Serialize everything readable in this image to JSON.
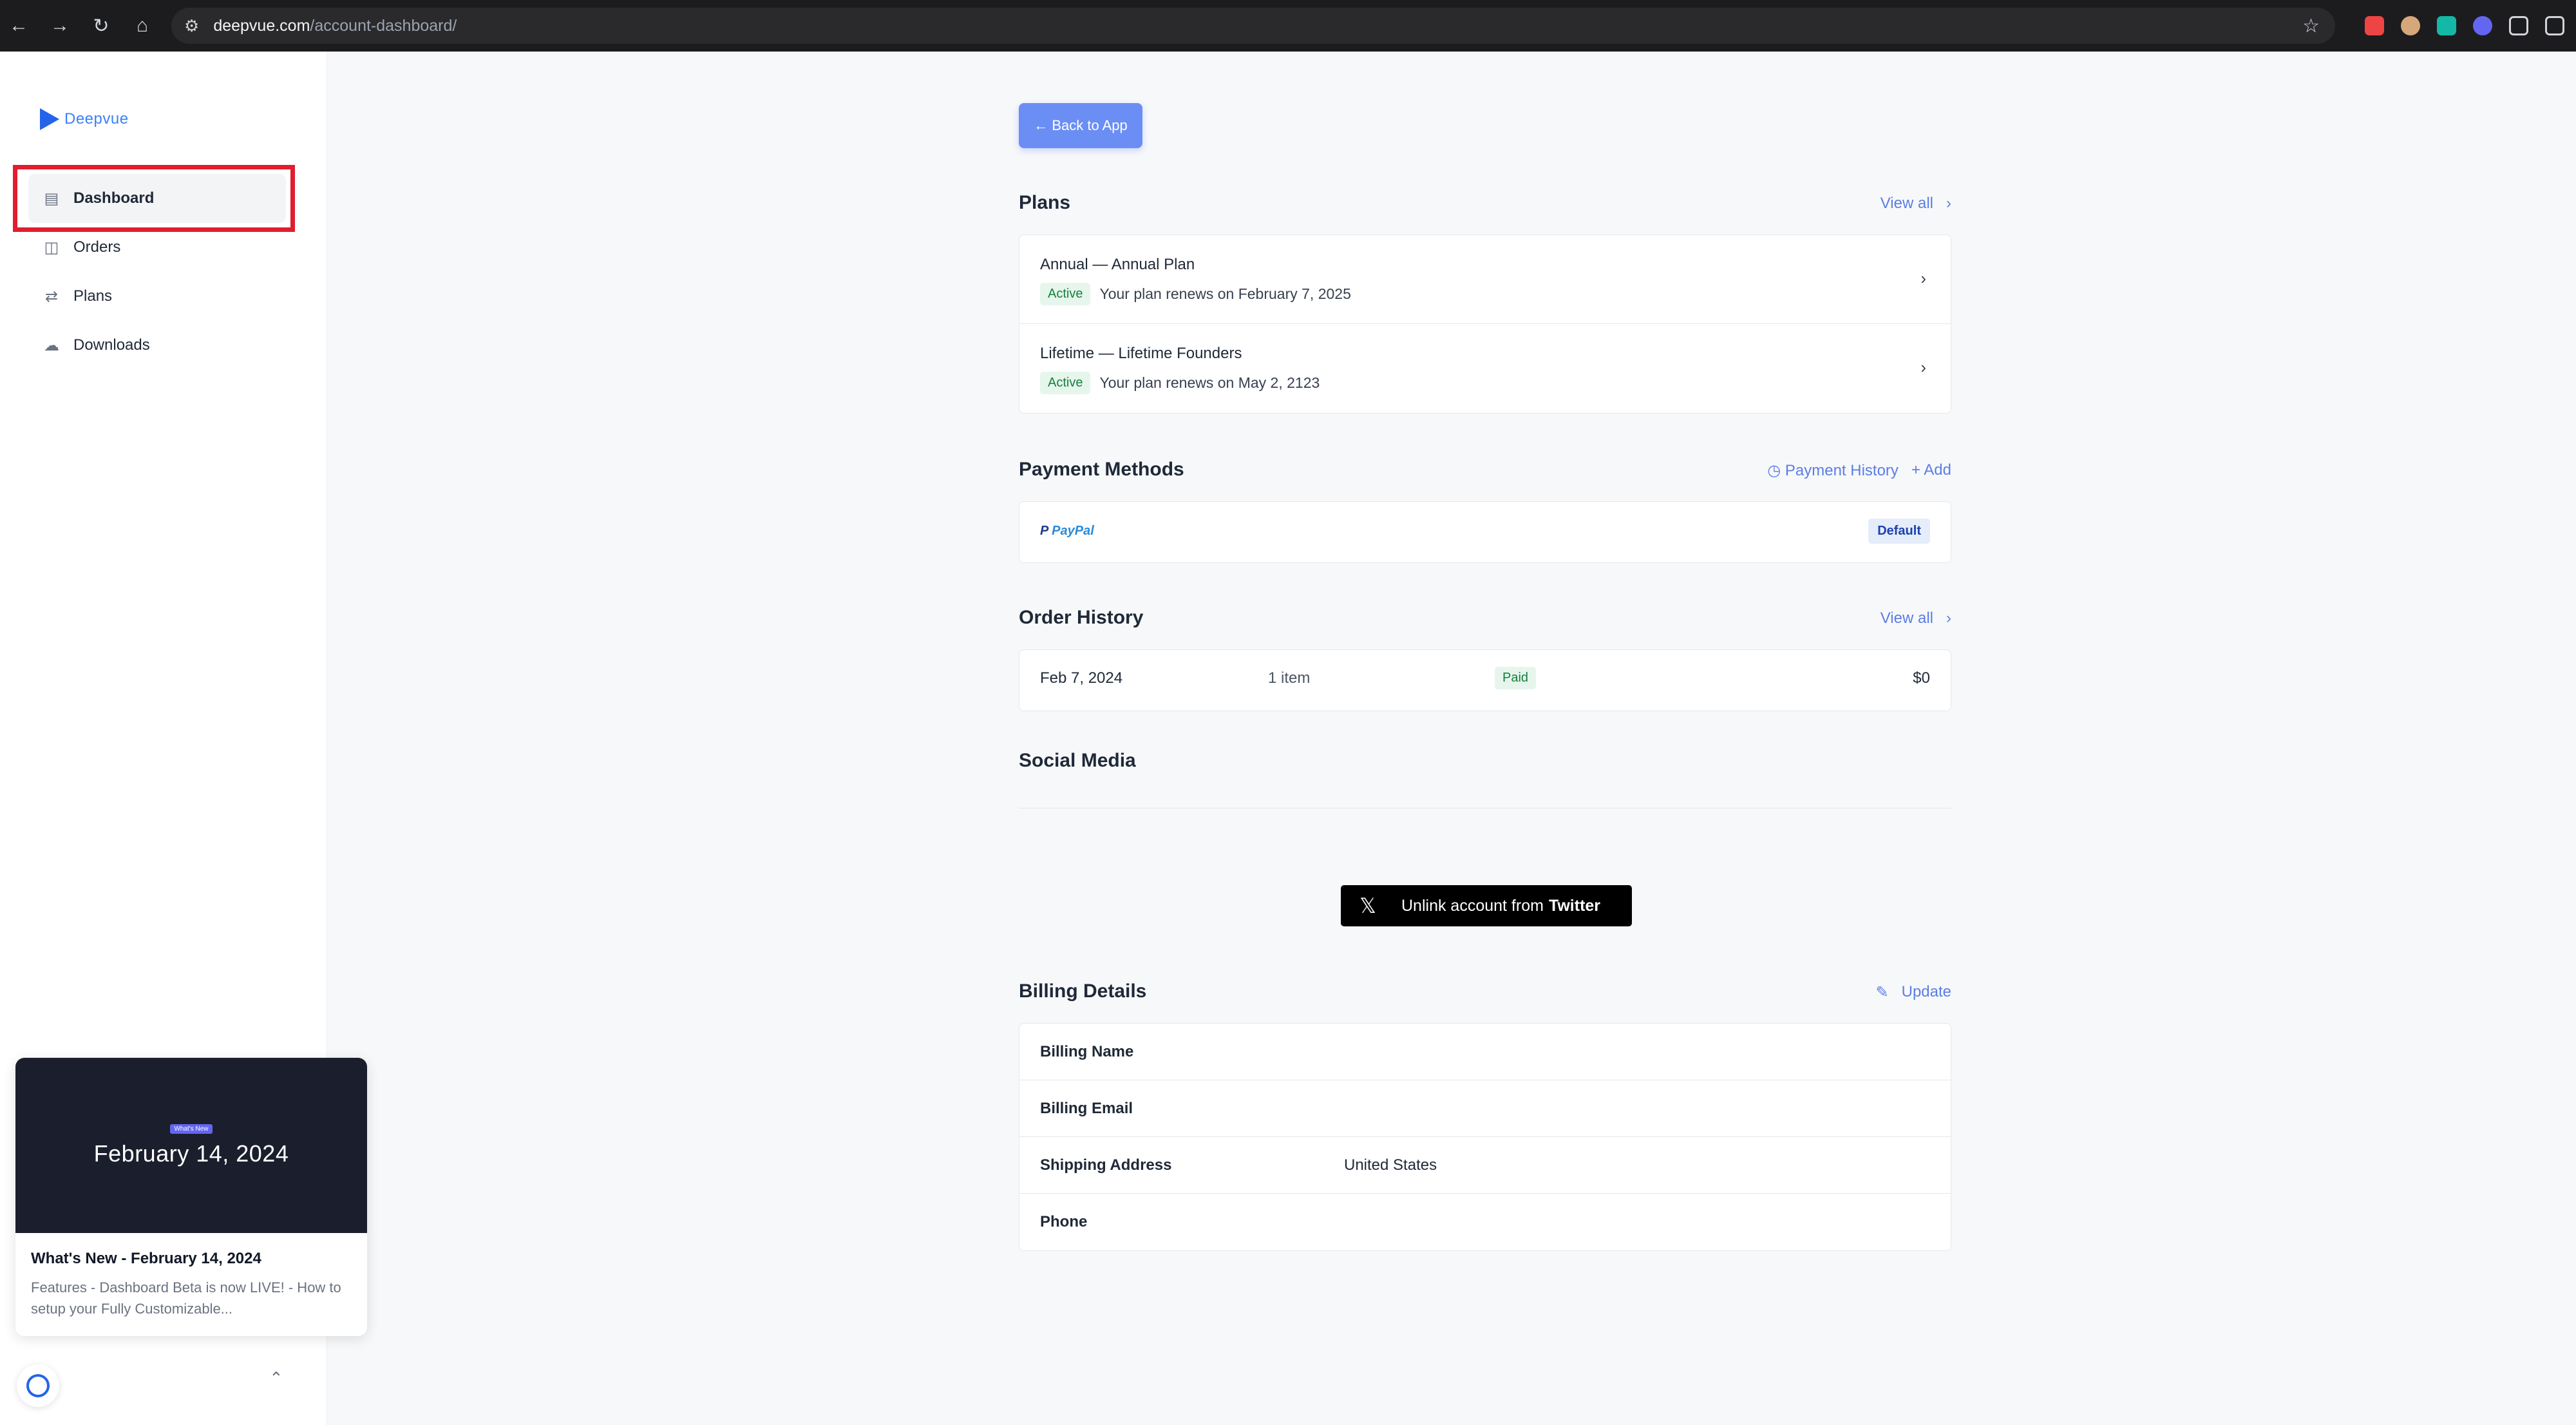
{
  "browser": {
    "url_host": "deepvue.com",
    "url_path": "/account-dashboard/"
  },
  "sidebar": {
    "logo_text": "Deepvue",
    "items": [
      {
        "label": "Dashboard",
        "icon": "dashboard-icon",
        "active": true
      },
      {
        "label": "Orders",
        "icon": "bag-icon",
        "active": false
      },
      {
        "label": "Plans",
        "icon": "refresh-icon",
        "active": false
      },
      {
        "label": "Downloads",
        "icon": "cloud-download-icon",
        "active": false
      }
    ]
  },
  "whats_new": {
    "tag": "What's New",
    "banner_date": "February 14, 2024",
    "title": "What's New - February 14, 2024",
    "description": "Features - Dashboard Beta is now LIVE! - How to setup your Fully Customizable..."
  },
  "main": {
    "back_button": "← Back to App",
    "plans": {
      "title": "Plans",
      "view_all": "View all",
      "rows": [
        {
          "name": "Annual — Annual Plan",
          "status": "Active",
          "renew": "Your plan renews on February 7, 2025"
        },
        {
          "name": "Lifetime — Lifetime Founders",
          "status": "Active",
          "renew": "Your plan renews on May 2, 2123"
        }
      ]
    },
    "payment_methods": {
      "title": "Payment Methods",
      "history_link": "Payment History",
      "add_link": "Add",
      "method_brand_1": "P",
      "method_brand_2": "PayPal",
      "default_badge": "Default"
    },
    "order_history": {
      "title": "Order History",
      "view_all": "View all",
      "rows": [
        {
          "date": "Feb 7, 2024",
          "items": "1 item",
          "status": "Paid",
          "amount": "$0"
        }
      ]
    },
    "social": {
      "title": "Social Media",
      "button_prefix": "Unlink account from",
      "button_brand": "Twitter"
    },
    "billing": {
      "title": "Billing Details",
      "update_link": "Update",
      "rows": [
        {
          "label": "Billing Name",
          "value": ""
        },
        {
          "label": "Billing Email",
          "value": ""
        },
        {
          "label": "Shipping Address",
          "value": "United States"
        },
        {
          "label": "Phone",
          "value": ""
        }
      ]
    }
  },
  "colors": {
    "accent": "#5b7ee5",
    "highlight": "#e11d2e",
    "active_green": "#15803d"
  }
}
